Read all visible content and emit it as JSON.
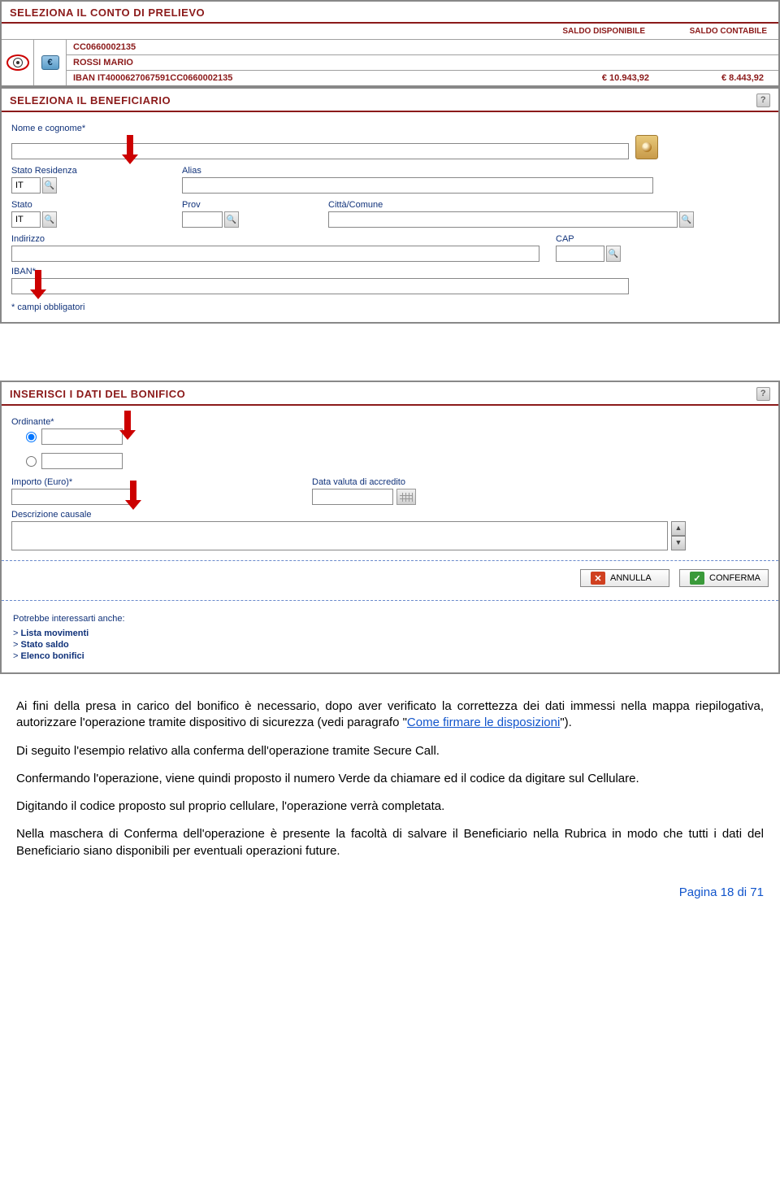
{
  "panel1": {
    "title": "SELEZIONA IL CONTO DI PRELIEVO",
    "balance_header_avail": "SALDO DISPONIBILE",
    "balance_header_cont": "SALDO CONTABILE",
    "currency_symbol": "€",
    "account_number": "CC0660002135",
    "holder": "ROSSI MARIO",
    "iban_label": "IBAN IT4000627067591CC0660002135",
    "bal_avail": "€ 10.943,92",
    "bal_cont": "€ 8.443,92"
  },
  "panel2": {
    "title": "SELEZIONA IL BENEFICIARIO",
    "nome_label": "Nome e cognome*",
    "stato_res_label": "Stato Residenza",
    "stato_res_val": "IT",
    "alias_label": "Alias",
    "stato_label": "Stato",
    "stato_val": "IT",
    "prov_label": "Prov",
    "citta_label": "Città/Comune",
    "indirizzo_label": "Indirizzo",
    "cap_label": "CAP",
    "iban_label": "IBAN*",
    "required_note": "* campi obbligatori"
  },
  "panel3": {
    "title": "INSERISCI I DATI DEL BONIFICO",
    "ordinante_label": "Ordinante*",
    "importo_label": "Importo (Euro)*",
    "data_valuta_label": "Data valuta di accredito",
    "descrizione_label": "Descrizione causale",
    "annulla": "ANNULLA",
    "conferma": "CONFERMA",
    "links_header": "Potrebbe interessarti anche:",
    "link1": "Lista movimenti",
    "link2": "Stato saldo",
    "link3": "Elenco bonifici"
  },
  "doc": {
    "p1a": "Ai fini della presa in carico del bonifico è necessario, dopo aver verificato la correttezza dei dati immessi nella mappa riepilogativa, autorizzare l'operazione tramite dispositivo di sicurezza (vedi paragrafo \"",
    "p1link": "Come firmare le disposizioni",
    "p1b": "\").",
    "p2": "Di seguito l'esempio relativo alla conferma dell'operazione tramite Secure Call.",
    "p3": "Confermando l'operazione, viene quindi proposto il numero Verde da chiamare ed il codice da digitare sul Cellulare.",
    "p4": "Digitando il codice proposto sul proprio cellulare, l'operazione verrà completata.",
    "p5": "Nella maschera di Conferma dell'operazione è presente la facoltà di salvare il Beneficiario nella Rubrica in modo che tutti i dati del Beneficiario siano disponibili per eventuali operazioni future."
  },
  "footer": "Pagina 18 di 71"
}
